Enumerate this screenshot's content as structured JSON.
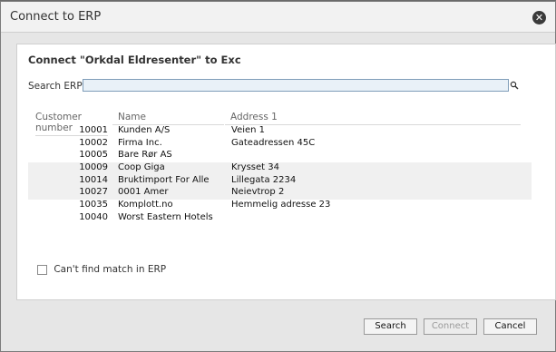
{
  "dialog": {
    "title": "Connect to ERP",
    "close_icon": "close-icon",
    "heading": "Connect \"Orkdal Eldresenter\" to Exc"
  },
  "search": {
    "label": "Search ERP:",
    "value": "",
    "icon": "search-icon"
  },
  "table": {
    "columns": [
      "Customer number",
      "Name",
      "Address 1"
    ],
    "rows": [
      {
        "number": "10001",
        "name": "Kunden A/S",
        "address": "Veien 1"
      },
      {
        "number": "10002",
        "name": "Firma Inc.",
        "address": "Gateadressen 45C"
      },
      {
        "number": "10005",
        "name": "Bare Rør AS",
        "address": ""
      },
      {
        "number": "10009",
        "name": "Coop Giga",
        "address": "Krysset 34"
      },
      {
        "number": "10014",
        "name": "Bruktimport For Alle",
        "address": "Lillegata 2234"
      },
      {
        "number": "10027",
        "name": "0001 Amer",
        "address": "Neievtrop 2"
      },
      {
        "number": "10035",
        "name": "Komplott.no",
        "address": "Hemmelig adresse 23"
      },
      {
        "number": "10040",
        "name": "Worst Eastern Hotels",
        "address": ""
      }
    ]
  },
  "checkbox": {
    "label": "Can't find match in ERP",
    "checked": false
  },
  "buttons": {
    "search": "Search",
    "connect": "Connect",
    "cancel": "Cancel"
  }
}
